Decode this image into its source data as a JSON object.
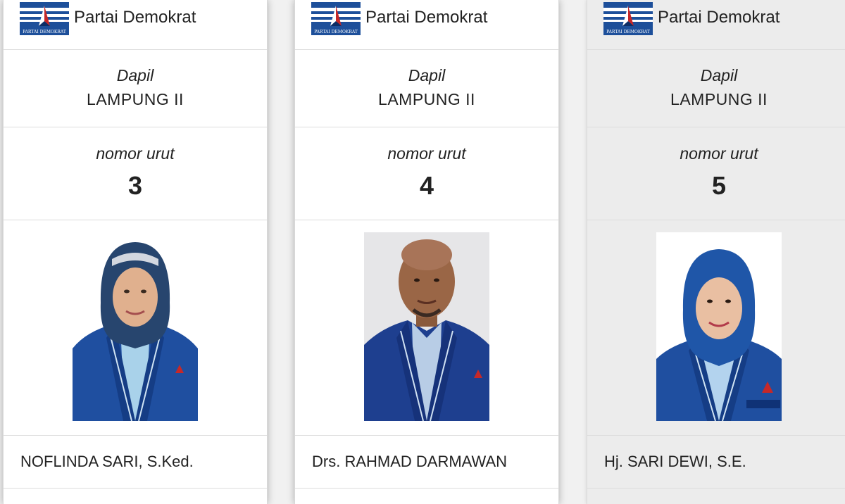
{
  "brand": {
    "logo_text": "PARTAI DEMOKRAT",
    "colors": {
      "blue": "#1d4f9a",
      "red": "#c62828",
      "white": "#ffffff"
    }
  },
  "cards": [
    {
      "party": "Partai Demokrat",
      "dapil_label": "Dapil",
      "dapil_value": "LAMPUNG II",
      "nomor_label": "nomor urut",
      "nomor_value": "3",
      "name": "NOFLINDA SARI, S.Ked.",
      "photo_background": "#ffffff"
    },
    {
      "party": "Partai Demokrat",
      "dapil_label": "Dapil",
      "dapil_value": "LAMPUNG II",
      "nomor_label": "nomor urut",
      "nomor_value": "4",
      "name": "Drs. RAHMAD DARMAWAN",
      "photo_background": "#e6e6e8"
    },
    {
      "party": "Partai Demokrat",
      "dapil_label": "Dapil",
      "dapil_value": "LAMPUNG II",
      "nomor_label": "nomor urut",
      "nomor_value": "5",
      "name": "Hj. SARI DEWI, S.E.",
      "photo_background": "#ffffff"
    }
  ]
}
